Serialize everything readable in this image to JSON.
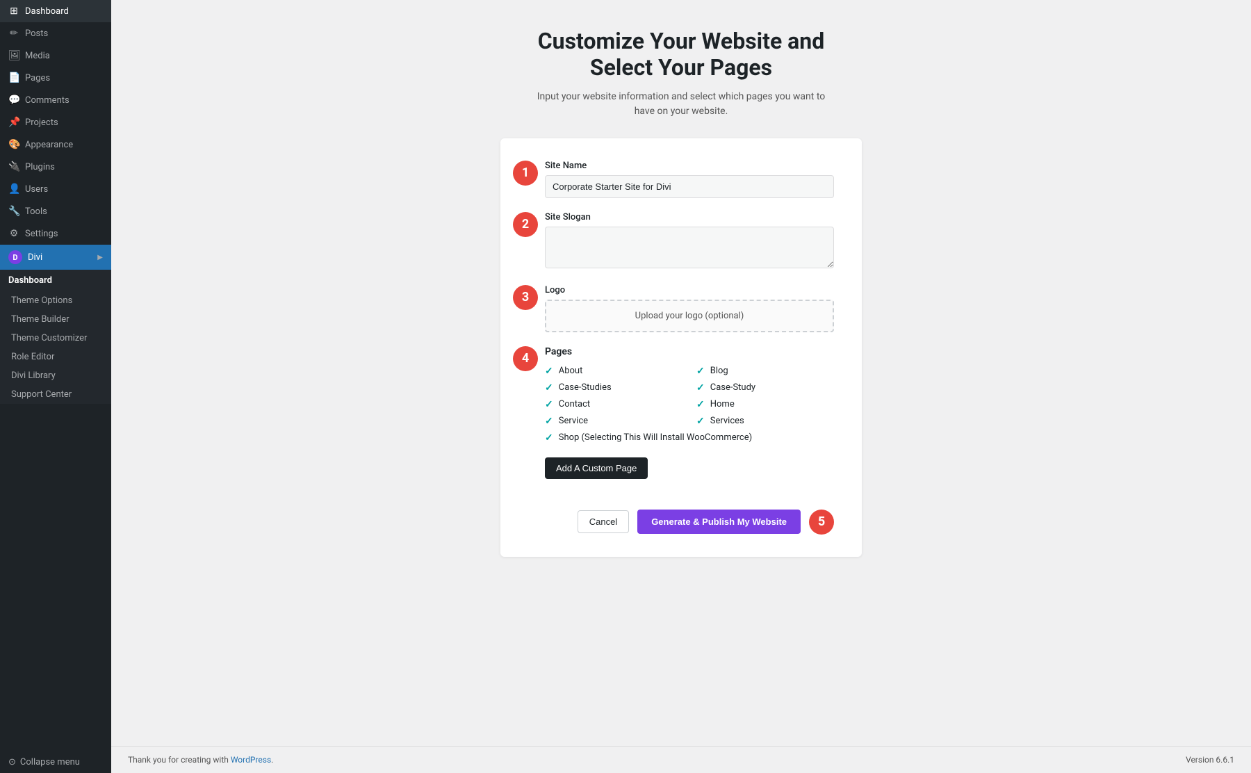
{
  "sidebar": {
    "items": [
      {
        "label": "Dashboard",
        "icon": "⊞"
      },
      {
        "label": "Posts",
        "icon": "✏"
      },
      {
        "label": "Media",
        "icon": "🖼"
      },
      {
        "label": "Pages",
        "icon": "📄"
      },
      {
        "label": "Comments",
        "icon": "💬"
      },
      {
        "label": "Projects",
        "icon": "📌"
      },
      {
        "label": "Appearance",
        "icon": "🎨"
      },
      {
        "label": "Plugins",
        "icon": "🔌"
      },
      {
        "label": "Users",
        "icon": "👤"
      },
      {
        "label": "Tools",
        "icon": "🔧"
      },
      {
        "label": "Settings",
        "icon": "⚙"
      }
    ],
    "divi_label": "Divi",
    "divi_sub_header": "Dashboard",
    "divi_sub_items": [
      "Theme Options",
      "Theme Builder",
      "Theme Customizer",
      "Role Editor",
      "Divi Library",
      "Support Center"
    ],
    "collapse_label": "Collapse menu"
  },
  "main": {
    "title_line1": "Customize Your Website and",
    "title_line2": "Select Your Pages",
    "subtitle": "Input your website information and select which pages you want to have on your website.",
    "form": {
      "site_name_label": "Site Name",
      "site_name_value": "Corporate Starter Site for Divi",
      "site_slogan_label": "Site Slogan",
      "site_slogan_placeholder": "",
      "logo_label": "Logo",
      "logo_upload_text": "Upload your logo (optional)",
      "pages_label": "Pages",
      "pages": [
        {
          "name": "About",
          "checked": true
        },
        {
          "name": "Blog",
          "checked": true
        },
        {
          "name": "Case-Studies",
          "checked": true
        },
        {
          "name": "Case-Study",
          "checked": true
        },
        {
          "name": "Contact",
          "checked": true
        },
        {
          "name": "Home",
          "checked": true
        },
        {
          "name": "Service",
          "checked": true
        },
        {
          "name": "Services",
          "checked": true
        },
        {
          "name": "Shop (Selecting This Will Install WooCommerce)",
          "checked": true
        }
      ],
      "add_custom_label": "Add A Custom Page",
      "cancel_label": "Cancel",
      "generate_label": "Generate & Publish My Website"
    }
  },
  "footer": {
    "text": "Thank you for creating with",
    "link_text": "WordPress",
    "version": "Version 6.6.1"
  },
  "steps": {
    "s1": "1",
    "s2": "2",
    "s3": "3",
    "s4": "4",
    "s5": "5"
  }
}
